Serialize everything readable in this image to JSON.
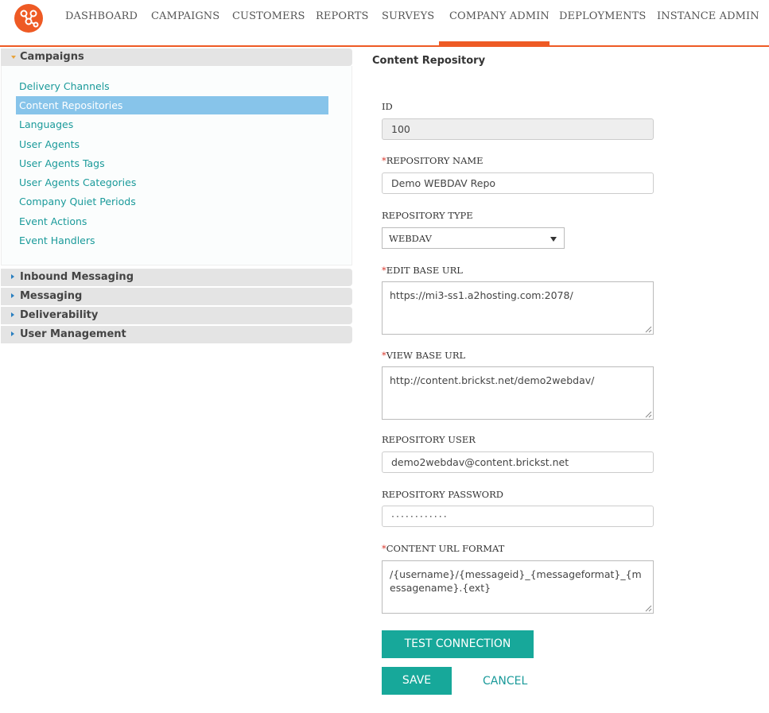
{
  "nav": {
    "items": [
      "DASHBOARD",
      "CAMPAIGNS",
      "CUSTOMERS",
      "REPORTS",
      "SURVEYS",
      "COMPANY ADMIN",
      "DEPLOYMENTS",
      "INSTANCE ADMIN"
    ],
    "active": "COMPANY ADMIN",
    "accent_color": "#ee5a24",
    "logo_icon": "network-nodes-logo"
  },
  "sidebar": {
    "campaigns": {
      "label": "Campaigns",
      "expanded": true,
      "links": [
        "Delivery Channels",
        "Content Repositories",
        "Languages",
        "User Agents",
        "User Agents Tags",
        "User Agents Categories",
        "Company Quiet Periods",
        "Event Actions",
        "Event Handlers"
      ],
      "active": "Content Repositories"
    },
    "sections": [
      "Inbound Messaging",
      "Messaging",
      "Deliverability",
      "User Management"
    ]
  },
  "form": {
    "title": "Content Repository",
    "id_label": "ID",
    "id_value": "100",
    "name_label": "REPOSITORY NAME",
    "name_value": "Demo WEBDAV Repo",
    "type_label": "REPOSITORY TYPE",
    "type_value": "WEBDAV",
    "edit_url_label": "EDIT BASE URL",
    "edit_url_value": "https://mi3-ss1.a2hosting.com:2078/",
    "view_url_label": "VIEW BASE URL",
    "view_url_value": "http://content.brickst.net/demo2webdav/",
    "user_label": "REPOSITORY USER",
    "user_value": "demo2webdav@content.brickst.net",
    "password_label": "REPOSITORY PASSWORD",
    "password_value": "············",
    "content_url_label": "CONTENT URL FORMAT",
    "content_url_value": "/{username}/{messageid}_{messageformat}_{messagename}.{ext}",
    "required_marker": "*"
  },
  "buttons": {
    "test_connection": "TEST CONNECTION",
    "save": "SAVE",
    "cancel": "CANCEL",
    "button_color": "#17a89a"
  }
}
